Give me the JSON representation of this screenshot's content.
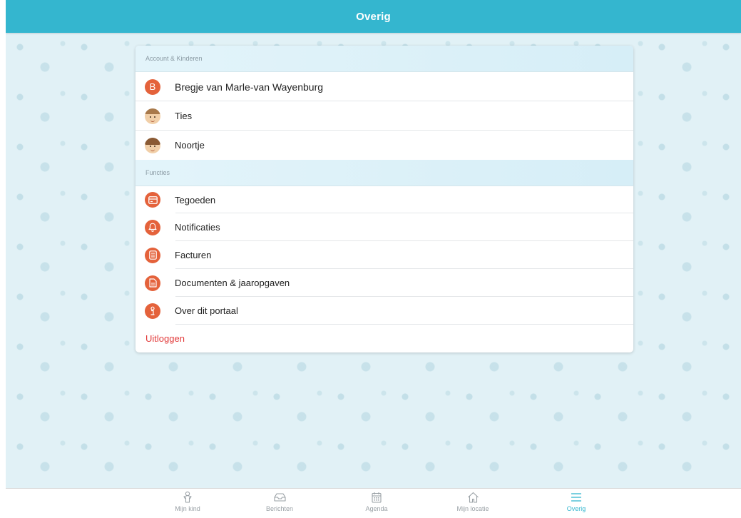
{
  "header": {
    "title": "Overig"
  },
  "sections": {
    "account": {
      "title": "Account & Kinderen",
      "user": {
        "initial": "B",
        "name": "Bregje van Marle-van Wayenburg"
      },
      "children": [
        {
          "name": "Ties"
        },
        {
          "name": "Noortje"
        }
      ]
    },
    "functions": {
      "title": "Functies",
      "items": [
        {
          "label": "Tegoeden",
          "icon": "credit-card-icon"
        },
        {
          "label": "Notificaties",
          "icon": "bell-icon"
        },
        {
          "label": "Facturen",
          "icon": "invoice-icon"
        },
        {
          "label": "Documenten & jaaropgaven",
          "icon": "document-icon"
        },
        {
          "label": "Over dit portaal",
          "icon": "info-icon"
        }
      ]
    },
    "logout": "Uitloggen"
  },
  "tabs": [
    {
      "label": "Mijn kind",
      "icon": "child-icon"
    },
    {
      "label": "Berichten",
      "icon": "inbox-icon"
    },
    {
      "label": "Agenda",
      "icon": "calendar-icon"
    },
    {
      "label": "Mijn locatie",
      "icon": "home-icon"
    },
    {
      "label": "Overig",
      "icon": "menu-icon",
      "active": true
    }
  ],
  "colors": {
    "header": "#34b6cf",
    "accent_icon": "#e4623b",
    "logout": "#e23b3b",
    "active_tab": "#34b6cf"
  }
}
